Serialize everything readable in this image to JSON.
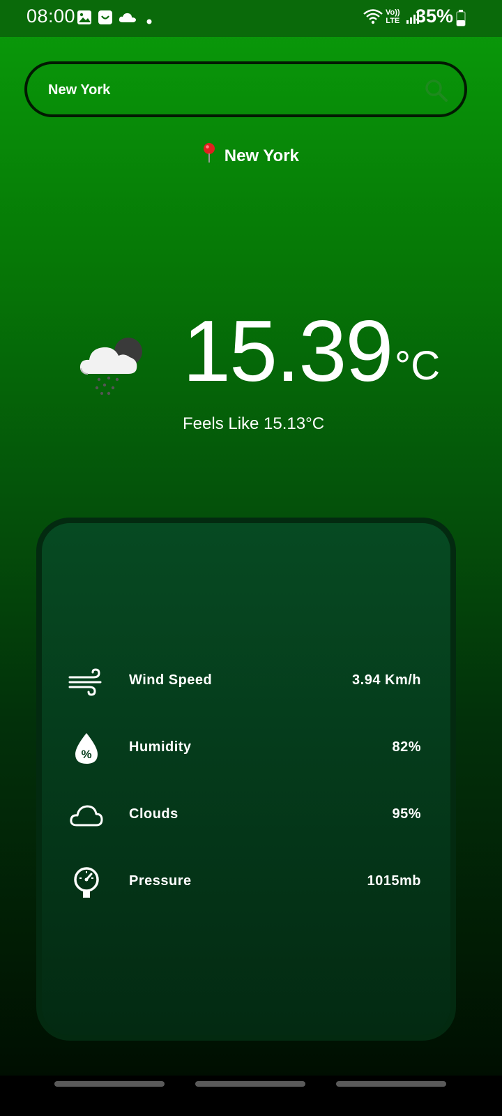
{
  "status_bar": {
    "time": "08:00",
    "battery_text": "35%",
    "network_label_top": "Vo))",
    "network_label_bottom": "LTE",
    "icons": [
      "gallery-icon",
      "store-bag-icon",
      "cloud-icon",
      "dot-icon",
      "wifi-icon",
      "signal-icon",
      "battery-icon"
    ]
  },
  "search": {
    "value": "New York",
    "icon": "search-icon"
  },
  "location": {
    "city": "New York",
    "icon": "pin-icon"
  },
  "current": {
    "temperature": "15.39",
    "unit": "°C",
    "feels_like": "Feels Like 15.13°C",
    "icon": "cloud-rain-night-icon"
  },
  "details": [
    {
      "label": "Wind Speed",
      "value": "3.94 Km/h",
      "icon": "wind-icon"
    },
    {
      "label": "Humidity",
      "value": "82%",
      "icon": "humidity-drop-icon"
    },
    {
      "label": "Clouds",
      "value": "95%",
      "icon": "cloud-outline-icon"
    },
    {
      "label": "Pressure",
      "value": "1015mb",
      "icon": "pressure-gauge-icon"
    }
  ],
  "colors": {
    "gradient_top": "#0a9c0a",
    "gradient_bottom": "#000a00",
    "card_background": "#053b1b",
    "search_border": "#021a02",
    "search_icon": "#1e8a1e",
    "pin": "#e02020"
  }
}
